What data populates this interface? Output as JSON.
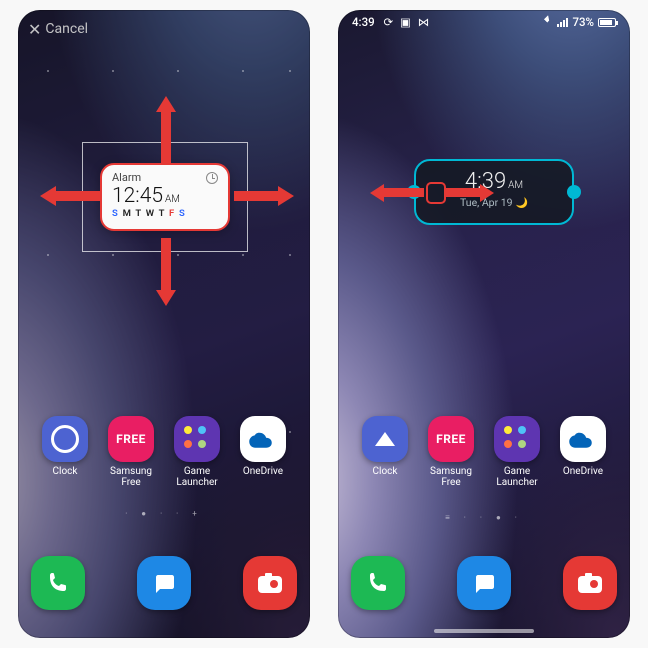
{
  "left": {
    "cancel_label": "Cancel",
    "widget": {
      "title": "Alarm",
      "time": "12:45",
      "ampm": "AM",
      "days": [
        "S",
        "M",
        "T",
        "W",
        "T",
        "F",
        "S"
      ]
    },
    "apps": [
      {
        "label": "Clock"
      },
      {
        "label": "Samsung Free",
        "iconText": "FREE"
      },
      {
        "label": "Game Launcher"
      },
      {
        "label": "OneDrive"
      }
    ],
    "page_indicator": "· ● · · +"
  },
  "right": {
    "status": {
      "time": "4:39",
      "battery": "73%"
    },
    "widget": {
      "time": "4:39",
      "ampm": "AM",
      "date": "Tue, Apr 19"
    },
    "apps": [
      {
        "label": "Clock"
      },
      {
        "label": "Samsung Free",
        "iconText": "FREE"
      },
      {
        "label": "Game Launcher"
      },
      {
        "label": "OneDrive"
      }
    ],
    "page_indicator": "≡ · · ● ·"
  }
}
